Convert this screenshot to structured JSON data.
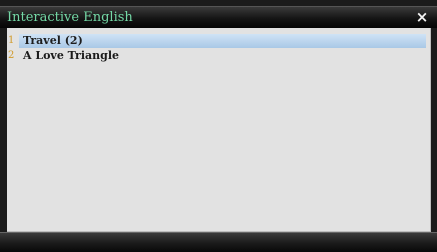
{
  "window": {
    "title": "Interactive English",
    "close_glyph": "×",
    "close_icon": "close-icon"
  },
  "list": {
    "items": [
      {
        "index": "1",
        "label": "Travel (2)",
        "selected": true
      },
      {
        "index": "2",
        "label": "A Love Triangle",
        "selected": false
      }
    ]
  },
  "colors": {
    "title_text": "#74d8a6",
    "index_text": "#d09a2a",
    "selection": "#a9c8e6",
    "panel_background": "#e2e2e2"
  }
}
